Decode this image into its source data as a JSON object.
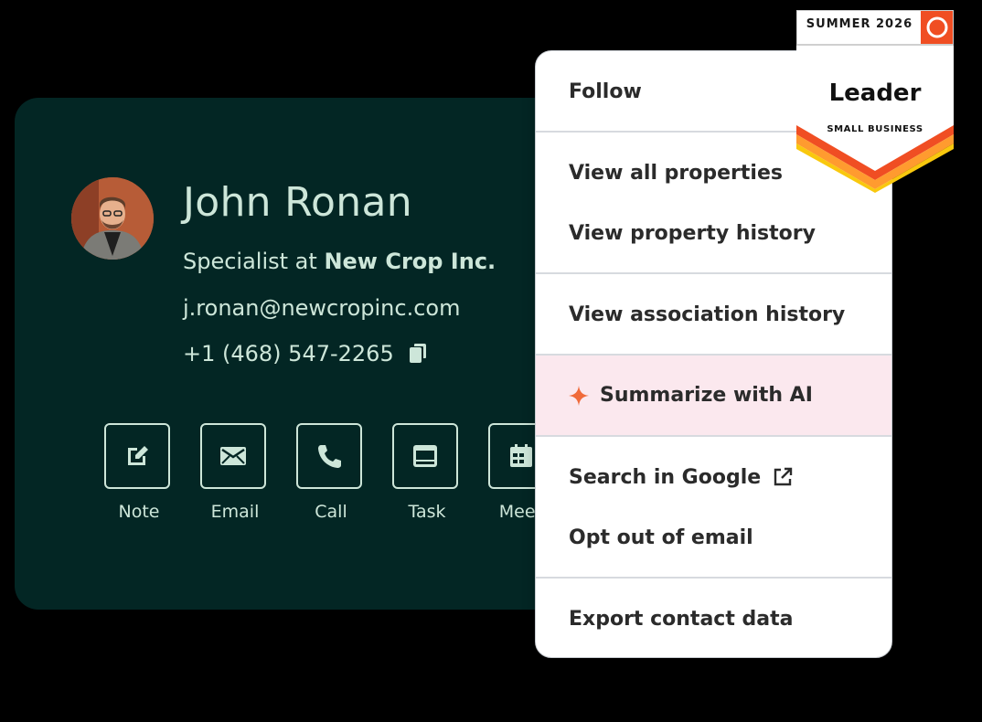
{
  "contact": {
    "name": "John Ronan",
    "title_prefix": "Specialist at ",
    "company": "New Crop Inc.",
    "email": "j.ronan@newcropinc.com",
    "phone": "+1 (468) 547-2265",
    "copy_icon": "copy-icon",
    "colors": {
      "card_bg": "#032624",
      "text": "#cde6d9"
    }
  },
  "actions": [
    {
      "label": "Note",
      "icon": "edit-note-icon"
    },
    {
      "label": "Email",
      "icon": "envelope-icon"
    },
    {
      "label": "Call",
      "icon": "phone-icon"
    },
    {
      "label": "Task",
      "icon": "task-icon"
    },
    {
      "label": "Meeti",
      "icon": "calendar-icon"
    }
  ],
  "menu": {
    "items": [
      {
        "label": "Follow"
      },
      {
        "label": "View all properties"
      },
      {
        "label": "View property history"
      },
      {
        "label": "View association history"
      },
      {
        "label": "Summarize with AI",
        "icon": "sparkle-icon",
        "highlight": "#fbe8ee",
        "icon_color": "#f06a3a"
      },
      {
        "label": "Search in Google",
        "icon": "external-link-icon"
      },
      {
        "label": "Opt out of email"
      },
      {
        "label": "Export contact data"
      }
    ]
  },
  "badge": {
    "season": "SUMMER 2026",
    "title": "Leader",
    "segment": "SMALL BUSINESS",
    "logo": "g2-logo",
    "colors": {
      "logo_bg": "#f04e23",
      "stripe_red": "#f04e23",
      "stripe_orange": "#ff9b2f",
      "stripe_yellow": "#f9c80e"
    }
  }
}
